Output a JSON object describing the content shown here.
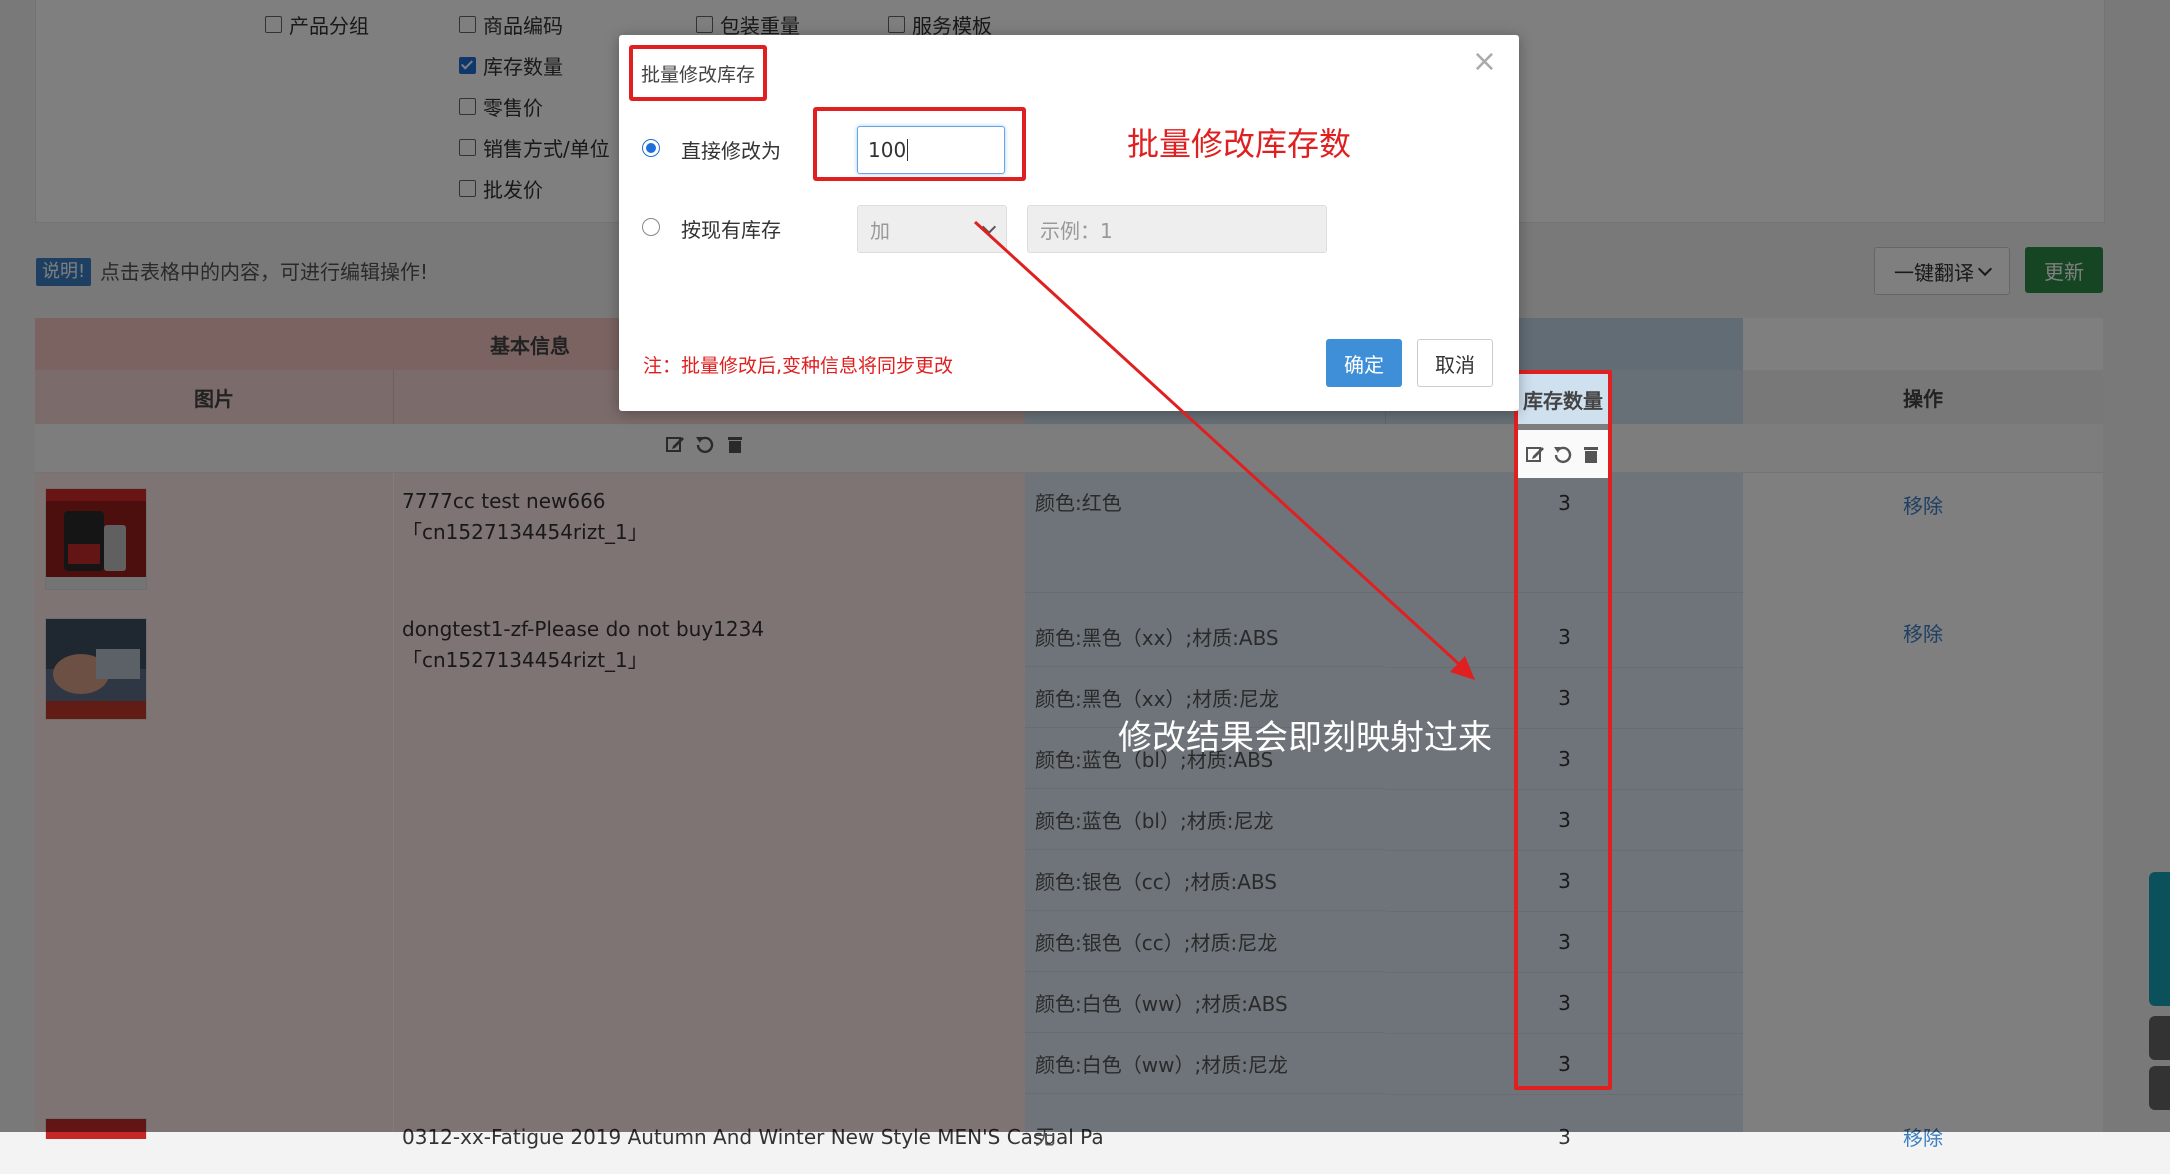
{
  "fields": {
    "col1": [
      {
        "label": "产品分组",
        "checked": false
      }
    ],
    "col2": [
      {
        "label": "商品编码",
        "checked": false
      },
      {
        "label": "库存数量",
        "checked": true
      },
      {
        "label": "零售价",
        "checked": false
      },
      {
        "label": "销售方式/单位",
        "checked": false
      },
      {
        "label": "批发价",
        "checked": false
      }
    ],
    "col3": [
      {
        "label": "包装重量",
        "checked": false
      }
    ],
    "col4": [
      {
        "label": "服务模板",
        "checked": false
      }
    ]
  },
  "notice": {
    "badge": "说明!",
    "text": "点击表格中的内容，可进行编辑操作!"
  },
  "toolbar": {
    "translate_label": "一键翻译",
    "update_label": "更新"
  },
  "table": {
    "group_basic": "基本信息",
    "headers": {
      "image": "图片",
      "stock": "库存数量",
      "operation": "操作"
    },
    "products": [
      {
        "name": "7777cc test new666",
        "sku": "「cn1527134454rizt_1」",
        "remove": "移除"
      },
      {
        "name": "dongtest1-zf-Please do not buy1234",
        "sku": "「cn1527134454rizt_1」",
        "remove": "移除"
      },
      {
        "name": "0312-xx-Fatigue 2019 Autumn And Winter New Style MEN'S Casual Pa",
        "remove": "移除"
      }
    ],
    "variants": [
      {
        "label": "颜色:红色",
        "stock": "3"
      },
      {
        "label": "颜色:黑色（xx）;材质:ABS",
        "stock": "3"
      },
      {
        "label": "颜色:黑色（xx）;材质:尼龙",
        "stock": "3"
      },
      {
        "label": "颜色:蓝色（bl）;材质:ABS",
        "stock": "3"
      },
      {
        "label": "颜色:蓝色（bl）;材质:尼龙",
        "stock": "3"
      },
      {
        "label": "颜色:银色（cc）;材质:ABS",
        "stock": "3"
      },
      {
        "label": "颜色:银色（cc）;材质:尼龙",
        "stock": "3"
      },
      {
        "label": "颜色:白色（ww）;材质:ABS",
        "stock": "3"
      },
      {
        "label": "颜色:白色（ww）;材质:尼龙",
        "stock": "3"
      },
      {
        "label": "无",
        "stock": "3"
      }
    ]
  },
  "modal": {
    "title": "批量修改库存",
    "close": "×",
    "option_direct": "直接修改为",
    "direct_value": "100",
    "option_relative": "按现有库存",
    "operator_selected": "加",
    "delta_placeholder": "示例：1",
    "note": "注：批量修改后,变种信息将同步更改",
    "confirm": "确定",
    "cancel": "取消",
    "selected_option": "direct"
  },
  "annotations": {
    "batch_label": "批量修改库存数",
    "result_label": "修改结果会即刻映射过来"
  },
  "colors": {
    "accent": "#1e6fd9",
    "annotation_red": "#e02020",
    "update_green": "#2a8b45"
  },
  "icons": [
    "edit-icon",
    "undo-icon",
    "trash-icon",
    "close-icon",
    "chevron-down-icon",
    "customer-service-icon",
    "help-icon",
    "back-to-top-icon"
  ]
}
